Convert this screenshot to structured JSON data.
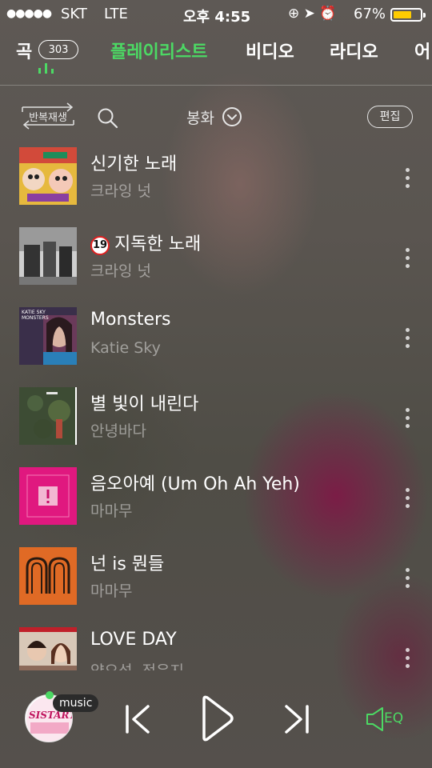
{
  "status_bar": {
    "signal": "●●●●●",
    "carrier": "SKT",
    "network": "LTE",
    "time": "오후 4:55",
    "icons": "⊕ ➤ ⏰",
    "battery": "67%"
  },
  "tabs": [
    {
      "label": "곡",
      "count": "303"
    },
    {
      "label": "플레이리스트"
    },
    {
      "label": "비디오"
    },
    {
      "label": "라디오"
    },
    {
      "label": "어"
    }
  ],
  "toolbar": {
    "repeat_label": "반복재생",
    "sort_label": "봉화",
    "edit_label": "편집"
  },
  "songs": [
    {
      "title": "신기한 노래",
      "artist": "크라잉 넛"
    },
    {
      "title": "지독한 노래",
      "artist": "크라잉 넛",
      "badge": "19"
    },
    {
      "title": "Monsters",
      "artist": "Katie Sky",
      "art_text": "KATIE SKY MONSTERS"
    },
    {
      "title": "별 빛이 내린다",
      "artist": "안녕바다"
    },
    {
      "title": "음오아예 (Um Oh Ah Yeh)",
      "artist": "마마무"
    },
    {
      "title": "넌 is 뭔들",
      "artist": "마마무"
    },
    {
      "title": "LOVE DAY",
      "artist": "양요섭, 정은지"
    }
  ],
  "player": {
    "album_text": "SISTAR19",
    "source_tag": "music",
    "eq_label": "EQ"
  },
  "colors": {
    "accent": "#4cd964",
    "battery": "#ffcc00"
  }
}
